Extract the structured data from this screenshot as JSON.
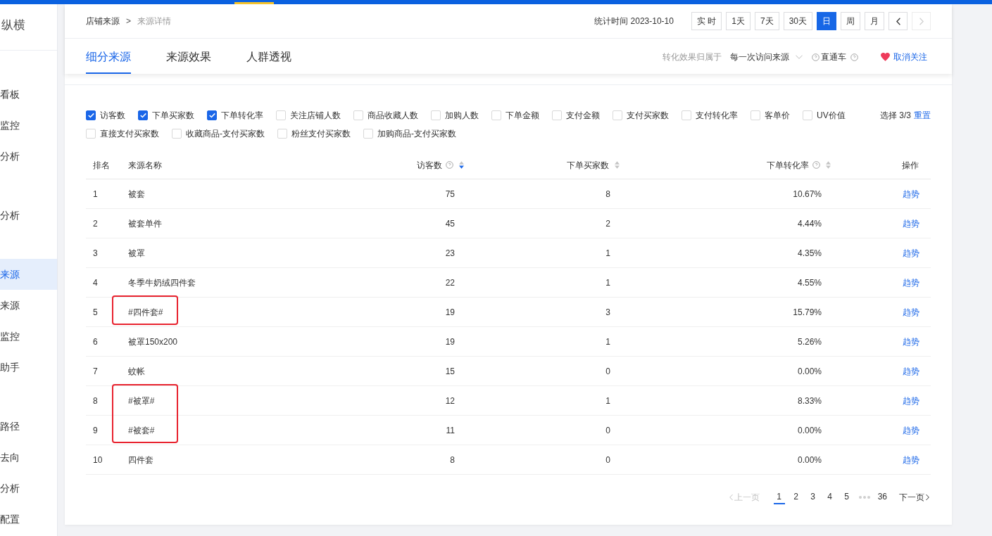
{
  "sidebar": {
    "brand": "纵横",
    "sections": [
      {
        "items": [
          {
            "label": "看板",
            "selected": false
          },
          {
            "label": "监控",
            "selected": false
          },
          {
            "label": "分析",
            "selected": false
          }
        ]
      },
      {
        "items": [
          {
            "label": "分析",
            "selected": false
          }
        ]
      },
      {
        "items": [
          {
            "label": "来源",
            "selected": true
          },
          {
            "label": "来源",
            "selected": false
          },
          {
            "label": "监控",
            "selected": false
          },
          {
            "label": "助手",
            "selected": false
          }
        ]
      },
      {
        "items": [
          {
            "label": "路径",
            "selected": false
          },
          {
            "label": "去向",
            "selected": false
          },
          {
            "label": "分析",
            "selected": false
          },
          {
            "label": "配置",
            "selected": false
          }
        ]
      }
    ]
  },
  "header": {
    "breadcrumb": [
      {
        "label": "店铺来源",
        "current": false
      },
      {
        "label": "来源详情",
        "current": true
      }
    ],
    "breadcrumb_separator": ">",
    "stat_time": "统计时间 2023-10-10",
    "periods": [
      {
        "label": "实 时",
        "selected": false
      },
      {
        "label": "1天",
        "selected": false
      },
      {
        "label": "7天",
        "selected": false
      },
      {
        "label": "30天",
        "selected": false
      },
      {
        "label": "日",
        "selected": true
      },
      {
        "label": "周",
        "selected": false
      },
      {
        "label": "月",
        "selected": false
      }
    ],
    "date_nav": [
      {
        "kind": "prev",
        "disabled": false
      },
      {
        "kind": "next",
        "disabled": true
      }
    ]
  },
  "tabs": [
    {
      "label": "细分来源",
      "selected": true
    },
    {
      "label": "来源效果",
      "selected": false
    },
    {
      "label": "人群透视",
      "selected": false
    }
  ],
  "tab_bar_right": {
    "attribution_label": "转化效果归属于",
    "attribution_value": "每一次访问来源",
    "channel_label": "直通车",
    "follow_label": "取消关注"
  },
  "metrics": {
    "options": [
      {
        "label": "访客数",
        "checked": true
      },
      {
        "label": "下单买家数",
        "checked": true
      },
      {
        "label": "下单转化率",
        "checked": true
      },
      {
        "label": "关注店铺人数",
        "checked": false
      },
      {
        "label": "商品收藏人数",
        "checked": false
      },
      {
        "label": "加购人数",
        "checked": false
      },
      {
        "label": "下单金额",
        "checked": false
      },
      {
        "label": "支付金额",
        "checked": false
      },
      {
        "label": "支付买家数",
        "checked": false
      },
      {
        "label": "支付转化率",
        "checked": false
      },
      {
        "label": "客单价",
        "checked": false
      },
      {
        "label": "UV价值",
        "checked": false
      },
      {
        "label": "直接支付买家数",
        "checked": false
      },
      {
        "label": "收藏商品-支付买家数",
        "checked": false
      },
      {
        "label": "粉丝支付买家数",
        "checked": false
      },
      {
        "label": "加购商品-支付买家数",
        "checked": false
      }
    ],
    "selection": "选择 3/3",
    "reset": "重置"
  },
  "table": {
    "columns": [
      {
        "label": "排名"
      },
      {
        "label": "来源名称"
      },
      {
        "label": "访客数",
        "help": true,
        "sortable": true,
        "sorted": true
      },
      {
        "label": "下单买家数",
        "sortable": true,
        "sorted": false
      },
      {
        "label": "下单转化率",
        "help": true,
        "sortable": true,
        "sorted": false
      },
      {
        "label": "操作"
      }
    ],
    "rows": [
      {
        "rank": "1",
        "name": "被套",
        "visitors": "75",
        "buyers": "8",
        "rate": "10.67%",
        "action": "趋势"
      },
      {
        "rank": "2",
        "name": "被套单件",
        "visitors": "45",
        "buyers": "2",
        "rate": "4.44%",
        "action": "趋势"
      },
      {
        "rank": "3",
        "name": "被罩",
        "visitors": "23",
        "buyers": "1",
        "rate": "4.35%",
        "action": "趋势"
      },
      {
        "rank": "4",
        "name": "冬季牛奶绒四件套",
        "visitors": "22",
        "buyers": "1",
        "rate": "4.55%",
        "action": "趋势"
      },
      {
        "rank": "5",
        "name": "#四件套#",
        "visitors": "19",
        "buyers": "3",
        "rate": "15.79%",
        "action": "趋势",
        "highlighted": true
      },
      {
        "rank": "6",
        "name": "被罩150x200",
        "visitors": "19",
        "buyers": "1",
        "rate": "5.26%",
        "action": "趋势"
      },
      {
        "rank": "7",
        "name": "蚊帐",
        "visitors": "15",
        "buyers": "0",
        "rate": "0.00%",
        "action": "趋势"
      },
      {
        "rank": "8",
        "name": "#被罩#",
        "visitors": "12",
        "buyers": "1",
        "rate": "8.33%",
        "action": "趋势",
        "highlighted": true
      },
      {
        "rank": "9",
        "name": "#被套#",
        "visitors": "11",
        "buyers": "0",
        "rate": "0.00%",
        "action": "趋势",
        "highlighted": true
      },
      {
        "rank": "10",
        "name": "四件套",
        "visitors": "8",
        "buyers": "0",
        "rate": "0.00%",
        "action": "趋势"
      }
    ]
  },
  "pagination": {
    "prev": {
      "label": "上一页",
      "disabled": true
    },
    "pages": [
      {
        "kind": "page",
        "label": "1",
        "selected": true
      },
      {
        "kind": "page",
        "label": "2",
        "selected": false
      },
      {
        "kind": "page",
        "label": "3",
        "selected": false
      },
      {
        "kind": "page",
        "label": "4",
        "selected": false
      },
      {
        "kind": "page",
        "label": "5",
        "selected": false
      },
      {
        "kind": "ellipsis"
      },
      {
        "kind": "page",
        "label": "36",
        "selected": false
      }
    ],
    "next": {
      "label": "下一页",
      "disabled": false
    }
  }
}
